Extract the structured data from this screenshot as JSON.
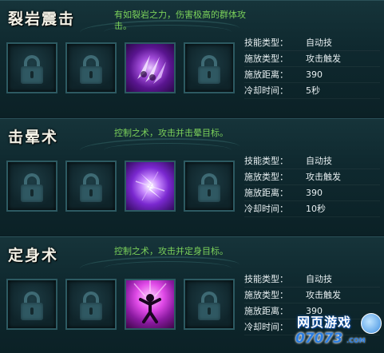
{
  "skills": [
    {
      "name": "裂岩震击",
      "description": "有如裂岩之力，伤害极高的群体攻击。",
      "icon": "claw-strike-icon",
      "stats": [
        {
          "key": "技能类型：",
          "value": "自动技"
        },
        {
          "key": "施放类型：",
          "value": "攻击触发"
        },
        {
          "key": "施放距离：",
          "value": "390"
        },
        {
          "key": "冷却时间：",
          "value": "5秒"
        }
      ]
    },
    {
      "name": "击晕术",
      "description": "控制之术，攻击并击晕目标。",
      "icon": "lightning-stun-icon",
      "stats": [
        {
          "key": "技能类型：",
          "value": "自动技"
        },
        {
          "key": "施放类型：",
          "value": "攻击触发"
        },
        {
          "key": "施放距离：",
          "value": "390"
        },
        {
          "key": "冷却时间：",
          "value": "10秒"
        }
      ]
    },
    {
      "name": "定身术",
      "description": "控制之术，攻击并定身目标。",
      "icon": "bind-figure-icon",
      "stats": [
        {
          "key": "技能类型：",
          "value": "自动技"
        },
        {
          "key": "施放类型：",
          "value": "攻击触发"
        },
        {
          "key": "施放距离：",
          "value": "390"
        },
        {
          "key": "冷却时间：",
          "value": ""
        }
      ]
    }
  ],
  "watermark": {
    "top": "网页游戏",
    "bottom": "07073",
    "domain": ".COM"
  },
  "colors": {
    "description": "#7bd15a",
    "slot_border": "#2d5a62",
    "background": "#0f292f"
  }
}
